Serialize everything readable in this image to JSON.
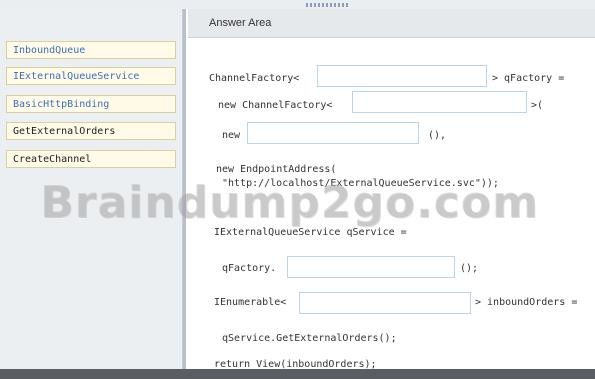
{
  "left_panel": {
    "items": [
      {
        "label": "InboundQueue",
        "style": "blue"
      },
      {
        "label": "IExternalQueueService",
        "style": "blue"
      },
      {
        "label": "BasicHttpBinding",
        "style": "blue"
      },
      {
        "label": "GetExternalOrders",
        "style": "dark"
      },
      {
        "label": "CreateChannel",
        "style": "dark"
      }
    ]
  },
  "answer_area": {
    "title": "Answer Area",
    "lines": {
      "l1a": "ChannelFactory<",
      "l1b": "> qFactory =",
      "l2a": "new ChannelFactory<",
      "l2b": ">(",
      "l3a": "new",
      "l3b": "(),",
      "l4a": "new EndpointAddress(",
      "l4b": "\"http://localhost/ExternalQueueService.svc\"));",
      "l5": "IExternalQueueService qService =",
      "l6a": "qFactory.",
      "l6b": "();",
      "l7a": "IEnumerable<",
      "l7b": "> inboundOrders =",
      "l8": "qService.GetExternalOrders();",
      "l9": "return View(inboundOrders);"
    }
  },
  "watermark": "Braindump2go.com",
  "colors": {
    "keyword": "#4a78b8",
    "chip_bg": "#fffbe8",
    "slot_border": "#bcd4e6"
  }
}
